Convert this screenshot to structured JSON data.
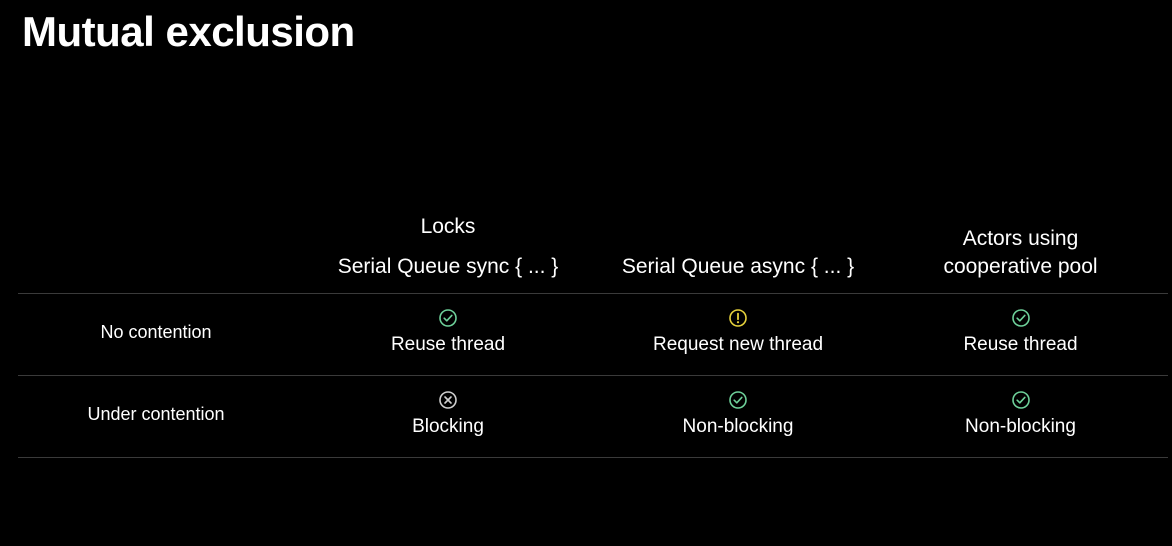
{
  "title": "Mutual exclusion",
  "columns": [
    {
      "line1": "Locks",
      "line2": "Serial Queue sync { ... }"
    },
    {
      "line1": "Serial Queue async { ... }"
    },
    {
      "line1": "Actors using",
      "line2": "cooperative pool"
    }
  ],
  "rows": [
    {
      "label": "No contention",
      "cells": [
        {
          "icon": "checkmark-icon",
          "text": "Reuse thread"
        },
        {
          "icon": "warning-icon",
          "text": "Request new thread"
        },
        {
          "icon": "checkmark-icon",
          "text": "Reuse thread"
        }
      ]
    },
    {
      "label": "Under contention",
      "cells": [
        {
          "icon": "x-circle-icon",
          "text": "Blocking"
        },
        {
          "icon": "checkmark-icon",
          "text": "Non-blocking"
        },
        {
          "icon": "checkmark-icon",
          "text": "Non-blocking"
        }
      ]
    }
  ],
  "colors": {
    "check": "#6ed19a",
    "warning": "#e6d23c",
    "x": "#cfcfcf",
    "divider": "#3a3a3a"
  }
}
